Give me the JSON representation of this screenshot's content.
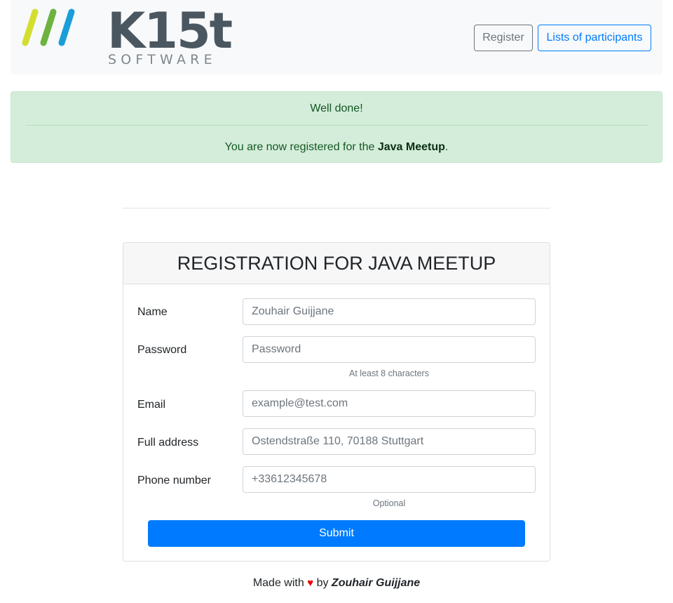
{
  "logo": {
    "text": "K15t",
    "subtext": "SOFTWARE",
    "stripe_colors": [
      "#d4de2f",
      "#6cb33f",
      "#1a9ed9"
    ]
  },
  "nav": {
    "register_label": "Register",
    "participants_label": "Lists of participants"
  },
  "alert": {
    "heading": "Well done!",
    "message_prefix": "You are now registered for the ",
    "event_name": "Java Meetup",
    "message_suffix": "."
  },
  "form": {
    "title": "REGISTRATION FOR JAVA MEETUP",
    "fields": {
      "name": {
        "label": "Name",
        "placeholder": "Zouhair Guijjane"
      },
      "password": {
        "label": "Password",
        "placeholder": "Password",
        "hint": "At least 8 characters"
      },
      "email": {
        "label": "Email",
        "placeholder": "example@test.com"
      },
      "address": {
        "label": "Full address",
        "placeholder": "Ostendstraße 110, 70188 Stuttgart"
      },
      "phone": {
        "label": "Phone number",
        "placeholder": "+33612345678",
        "hint": "Optional"
      }
    },
    "submit_label": "Submit"
  },
  "footer": {
    "prefix": "Made with",
    "heart_icon": "heart-icon",
    "by": "by",
    "author": "Zouhair Guijjane"
  },
  "colors": {
    "primary": "#007bff",
    "secondary": "#6c757d",
    "success_bg": "#d4edda",
    "success_text": "#155724",
    "heart": "#ee0000"
  }
}
